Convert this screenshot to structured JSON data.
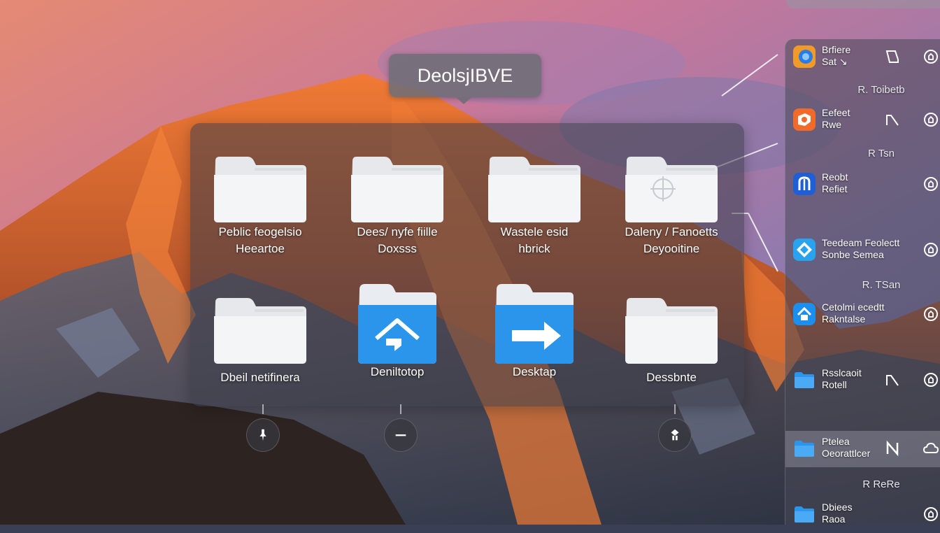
{
  "title": {
    "text": "DeolsjIBVE"
  },
  "stack": {
    "items": [
      {
        "line1": "Peblic feogelsio",
        "line2": "Heeartoe",
        "icon": "folder-icon"
      },
      {
        "line1": "Dees/ nyfe fiille",
        "line2": "Doxsss",
        "icon": "folder-icon"
      },
      {
        "line1": "Wastele esid",
        "line2": "hbrick",
        "icon": "folder-icon"
      },
      {
        "line1": "Daleny / Fanoetts",
        "line2": "Deyooitine",
        "icon": "folder-crosshair-icon"
      },
      {
        "line1": "Dbeil netifinera",
        "line2": "",
        "icon": "folder-icon"
      },
      {
        "line1": "Deniltotop",
        "line2": "",
        "icon": "home-folder-icon"
      },
      {
        "line1": "Desktap",
        "line2": "",
        "icon": "arrow-folder-icon"
      },
      {
        "line1": "Dessbnte",
        "line2": "",
        "icon": "folder-icon"
      }
    ]
  },
  "actions": [
    {
      "icon": "pin-icon"
    },
    {
      "icon": "minus-icon"
    },
    {
      "icon": "settings-icon"
    }
  ],
  "sidebar": {
    "rows": [
      {
        "line1": "Brfiere",
        "line2": "Sat  ↘",
        "icon": "app-orange-blue-icon"
      },
      {
        "line1": "Eefeet",
        "line2": "Rwe",
        "icon": "app-orange-icon"
      },
      {
        "line1": "Reobt",
        "line2": "Refiet",
        "icon": "app-blue-a-icon"
      },
      {
        "line1": "Teedeam Feolectt",
        "line2": "Sonbe    Semea",
        "icon": "app-sky-icon"
      },
      {
        "line1": "Cetolmi ecedtt",
        "line2": "Rakntalse",
        "icon": "home-app-icon"
      },
      {
        "line1": "Rsslcaoit",
        "line2": "Rotell",
        "icon": "folder-blue-icon"
      },
      {
        "line1": "Ptelea",
        "line2": "Oeorattlcer",
        "icon": "folder-blue-icon"
      },
      {
        "line1": "Dbiees",
        "line2": "Raoa",
        "icon": "folder-blue-icon"
      }
    ],
    "sections": [
      "R. Toibetb",
      "R Tsn",
      "R. TSan",
      "R ReRe"
    ]
  },
  "colors": {
    "accent": "#1a8ff0",
    "folder_white": "#f2f3f5",
    "folder_blue": "#2b95ec"
  }
}
